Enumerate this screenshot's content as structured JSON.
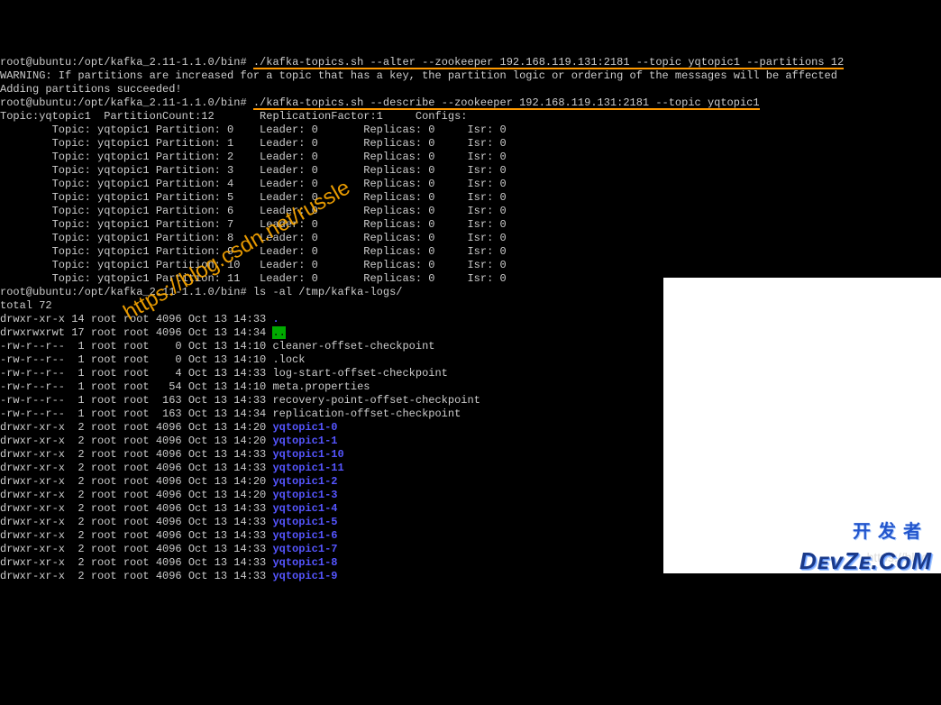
{
  "prompt_prefix": "root@ubuntu:/opt/kafka_2.11-1.1.0/bin# ",
  "cmd1": "./kafka-topics.sh --alter --zookeeper 192.168.119.131:2181 --topic yqtopic1 --partitions 12",
  "warning_line": "WARNING: If partitions are increased for a topic that has a key, the partition logic or ordering of the messages will be affected",
  "success_line": "Adding partitions succeeded!",
  "cmd2": "./kafka-topics.sh --describe --zookeeper 192.168.119.131:2181 --topic yqtopic1",
  "describe_header": "Topic:yqtopic1  PartitionCount:12       ReplicationFactor:1     Configs:",
  "partitions": [
    {
      "topic": "yqtopic1",
      "partition": 0,
      "leader": 0,
      "replicas": 0,
      "isr": 0
    },
    {
      "topic": "yqtopic1",
      "partition": 1,
      "leader": 0,
      "replicas": 0,
      "isr": 0
    },
    {
      "topic": "yqtopic1",
      "partition": 2,
      "leader": 0,
      "replicas": 0,
      "isr": 0
    },
    {
      "topic": "yqtopic1",
      "partition": 3,
      "leader": 0,
      "replicas": 0,
      "isr": 0
    },
    {
      "topic": "yqtopic1",
      "partition": 4,
      "leader": 0,
      "replicas": 0,
      "isr": 0
    },
    {
      "topic": "yqtopic1",
      "partition": 5,
      "leader": 0,
      "replicas": 0,
      "isr": 0
    },
    {
      "topic": "yqtopic1",
      "partition": 6,
      "leader": 0,
      "replicas": 0,
      "isr": 0
    },
    {
      "topic": "yqtopic1",
      "partition": 7,
      "leader": 0,
      "replicas": 0,
      "isr": 0
    },
    {
      "topic": "yqtopic1",
      "partition": 8,
      "leader": 0,
      "replicas": 0,
      "isr": 0
    },
    {
      "topic": "yqtopic1",
      "partition": 9,
      "leader": 0,
      "replicas": 0,
      "isr": 0
    },
    {
      "topic": "yqtopic1",
      "partition": 10,
      "leader": 0,
      "replicas": 0,
      "isr": 0
    },
    {
      "topic": "yqtopic1",
      "partition": 11,
      "leader": 0,
      "replicas": 0,
      "isr": 0
    }
  ],
  "cmd3": "ls -al /tmp/kafka-logs/",
  "total_line": "total 72",
  "ls": [
    {
      "perm": "drwxr-xr-x",
      "links": 14,
      "owner": "root",
      "group": "root",
      "size": 4096,
      "date": "Oct 13 14:33",
      "name": ".",
      "dir": true,
      "hl": false
    },
    {
      "perm": "drwxrwxrwt",
      "links": 17,
      "owner": "root",
      "group": "root",
      "size": 4096,
      "date": "Oct 13 14:34",
      "name": "..",
      "dir": true,
      "hl": true
    },
    {
      "perm": "-rw-r--r--",
      "links": 1,
      "owner": "root",
      "group": "root",
      "size": 0,
      "date": "Oct 13 14:10",
      "name": "cleaner-offset-checkpoint",
      "dir": false
    },
    {
      "perm": "-rw-r--r--",
      "links": 1,
      "owner": "root",
      "group": "root",
      "size": 0,
      "date": "Oct 13 14:10",
      "name": ".lock",
      "dir": false
    },
    {
      "perm": "-rw-r--r--",
      "links": 1,
      "owner": "root",
      "group": "root",
      "size": 4,
      "date": "Oct 13 14:33",
      "name": "log-start-offset-checkpoint",
      "dir": false
    },
    {
      "perm": "-rw-r--r--",
      "links": 1,
      "owner": "root",
      "group": "root",
      "size": 54,
      "date": "Oct 13 14:10",
      "name": "meta.properties",
      "dir": false
    },
    {
      "perm": "-rw-r--r--",
      "links": 1,
      "owner": "root",
      "group": "root",
      "size": 163,
      "date": "Oct 13 14:33",
      "name": "recovery-point-offset-checkpoint",
      "dir": false
    },
    {
      "perm": "-rw-r--r--",
      "links": 1,
      "owner": "root",
      "group": "root",
      "size": 163,
      "date": "Oct 13 14:34",
      "name": "replication-offset-checkpoint",
      "dir": false
    },
    {
      "perm": "drwxr-xr-x",
      "links": 2,
      "owner": "root",
      "group": "root",
      "size": 4096,
      "date": "Oct 13 14:20",
      "name": "yqtopic1-0",
      "dir": true
    },
    {
      "perm": "drwxr-xr-x",
      "links": 2,
      "owner": "root",
      "group": "root",
      "size": 4096,
      "date": "Oct 13 14:20",
      "name": "yqtopic1-1",
      "dir": true
    },
    {
      "perm": "drwxr-xr-x",
      "links": 2,
      "owner": "root",
      "group": "root",
      "size": 4096,
      "date": "Oct 13 14:33",
      "name": "yqtopic1-10",
      "dir": true
    },
    {
      "perm": "drwxr-xr-x",
      "links": 2,
      "owner": "root",
      "group": "root",
      "size": 4096,
      "date": "Oct 13 14:33",
      "name": "yqtopic1-11",
      "dir": true
    },
    {
      "perm": "drwxr-xr-x",
      "links": 2,
      "owner": "root",
      "group": "root",
      "size": 4096,
      "date": "Oct 13 14:20",
      "name": "yqtopic1-2",
      "dir": true
    },
    {
      "perm": "drwxr-xr-x",
      "links": 2,
      "owner": "root",
      "group": "root",
      "size": 4096,
      "date": "Oct 13 14:20",
      "name": "yqtopic1-3",
      "dir": true
    },
    {
      "perm": "drwxr-xr-x",
      "links": 2,
      "owner": "root",
      "group": "root",
      "size": 4096,
      "date": "Oct 13 14:33",
      "name": "yqtopic1-4",
      "dir": true
    },
    {
      "perm": "drwxr-xr-x",
      "links": 2,
      "owner": "root",
      "group": "root",
      "size": 4096,
      "date": "Oct 13 14:33",
      "name": "yqtopic1-5",
      "dir": true
    },
    {
      "perm": "drwxr-xr-x",
      "links": 2,
      "owner": "root",
      "group": "root",
      "size": 4096,
      "date": "Oct 13 14:33",
      "name": "yqtopic1-6",
      "dir": true
    },
    {
      "perm": "drwxr-xr-x",
      "links": 2,
      "owner": "root",
      "group": "root",
      "size": 4096,
      "date": "Oct 13 14:33",
      "name": "yqtopic1-7",
      "dir": true
    },
    {
      "perm": "drwxr-xr-x",
      "links": 2,
      "owner": "root",
      "group": "root",
      "size": 4096,
      "date": "Oct 13 14:33",
      "name": "yqtopic1-8",
      "dir": true
    },
    {
      "perm": "drwxr-xr-x",
      "links": 2,
      "owner": "root",
      "group": "root",
      "size": 4096,
      "date": "Oct 13 14:33",
      "name": "yqtopic1-9",
      "dir": true
    }
  ],
  "watermark1": "https://blog.csdn.net/russle",
  "watermark2": "https://blog.",
  "devze_cn": "开发者",
  "devze_logo": "DᴇᴠZᴇ.CᴏM"
}
